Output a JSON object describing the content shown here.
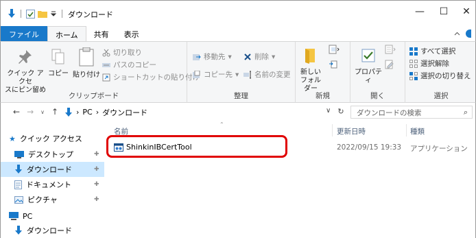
{
  "window": {
    "title": "ダウンロード",
    "minimize": "—",
    "maximize": "☐",
    "close": "✕",
    "separator": "|"
  },
  "tabs": [
    {
      "label": "ファイル"
    },
    {
      "label": "ホーム"
    },
    {
      "label": "共有"
    },
    {
      "label": "表示"
    }
  ],
  "ribbon": {
    "clipboard": {
      "label": "クリップボード",
      "pin": "クイック アクセス にピン留め",
      "pin_l1": "クイック アクセ",
      "pin_l2": "スにピン留め",
      "copy": "コピー",
      "paste": "貼り付け",
      "cut": "切り取り",
      "copy_path": "パスのコピー",
      "paste_shortcut": "ショートカットの貼り付け"
    },
    "organize": {
      "label": "整理",
      "move_to": "移動先",
      "copy_to": "コピー先",
      "delete": "削除",
      "rename": "名前の変更"
    },
    "new": {
      "label": "新規",
      "new_folder_l1": "新しい",
      "new_folder_l2": "フォルダー"
    },
    "open": {
      "label": "開く",
      "properties": "プロパティ"
    },
    "select": {
      "label": "選択",
      "select_all": "すべて選択",
      "select_none": "選択解除",
      "invert": "選択の切り替え"
    }
  },
  "address": {
    "back": "←",
    "forward": "→",
    "up": "↑",
    "crumbs": [
      "PC",
      "ダウンロード"
    ],
    "chev": "›",
    "dropdown": "∨",
    "refresh": "↻",
    "search_placeholder": "ダウンロードの検索"
  },
  "nav": {
    "quick_access": "クイック アクセス",
    "items": [
      {
        "label": "デスクトップ"
      },
      {
        "label": "ダウンロード"
      },
      {
        "label": "ドキュメント"
      },
      {
        "label": "ピクチャ"
      }
    ],
    "pc": "PC",
    "pc_downloads": "ダウンロード"
  },
  "columns": {
    "name": "名前",
    "date": "更新日時",
    "type": "種類"
  },
  "files": [
    {
      "name": "ShinkinIBCertTool",
      "date": "2022/09/15 19:33",
      "type": "アプリケーション"
    }
  ],
  "colors": {
    "accent": "#1979ca",
    "highlight": "#e00000",
    "selected": "#cce8ff"
  }
}
